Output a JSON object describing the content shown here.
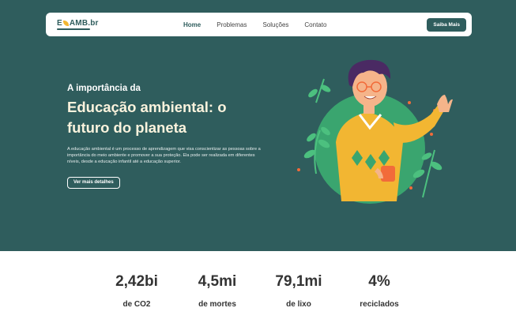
{
  "nav": {
    "logo_left": "E",
    "logo_right": "AMB.br",
    "links": [
      "Home",
      "Problemas",
      "Soluções",
      "Contato"
    ],
    "cta_label": "Saiba Mais"
  },
  "hero": {
    "pre_title": "A importância da",
    "title_line1": "Educação ambiental: o",
    "title_line2": "futuro do planeta",
    "description": "A educação ambiental é um processo de aprendizagem que visa conscientizar as pessoas sobre a importância do meio ambiente e promover a sua proteção. Ela pode ser realizada em diferentes níveis, desde a educação infantil até a educação superior.",
    "button_label": "Ver mais detalhes"
  },
  "stats": [
    {
      "value": "2,42bi",
      "label": "de CO2"
    },
    {
      "value": "4,5mi",
      "label": "de mortes"
    },
    {
      "value": "79,1mi",
      "label": "de lixo"
    },
    {
      "value": "4%",
      "label": "reciclados"
    }
  ],
  "colors": {
    "primary": "#2f5d5d",
    "accent_yellow": "#f2b632",
    "leaf_green": "#3aa56f",
    "title_cream": "#fbf3dd"
  }
}
